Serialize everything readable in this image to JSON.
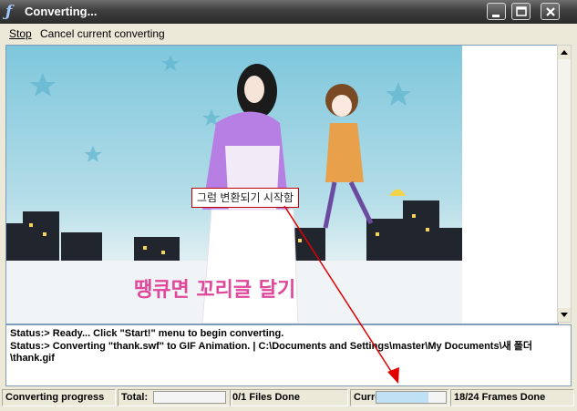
{
  "window": {
    "title": "Converting...",
    "icon": "flash-icon",
    "controls": [
      "minimize-icon",
      "maximize-icon",
      "close-icon"
    ]
  },
  "menu": {
    "stop_label": "Stop",
    "cancel_label": "Cancel current converting"
  },
  "preview": {
    "tooltip_text": "그럼 변환되기 시작함",
    "caption": "땡큐면 꼬리글 달기"
  },
  "status": {
    "lines": [
      "Status:> Ready... Click \"Start!\" menu to begin converting.",
      "Status:> Converting \"thank.swf\" to GIF Animation. | C:\\Documents and Settings\\master\\My Documents\\새 폴더\\thank.gif"
    ]
  },
  "statusbar": {
    "label": "Converting progress",
    "total_label": "Total:",
    "total_progress": 0,
    "files_done": "0/1 Files Done",
    "current_label": "Current:",
    "current_progress": 0.75,
    "frames_done": "18/24 Frames Done"
  },
  "colors": {
    "annotation": "#e00000",
    "progress_fill": "#bfe0f5"
  }
}
